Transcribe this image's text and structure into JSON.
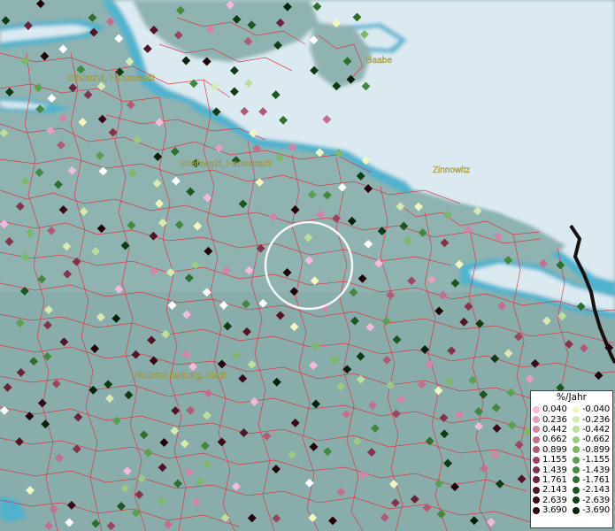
{
  "map": {
    "cities": [
      {
        "name": "Stralsund, Hansestadt"
      },
      {
        "name": "Baabe"
      },
      {
        "name": "Greifswald, Hansestadt"
      },
      {
        "name": "Zinnowitz"
      },
      {
        "name": "Neubrandenburg, Stadt"
      }
    ]
  },
  "legend": {
    "title": "%/Jahr",
    "positive": [
      {
        "value": "0.040",
        "color": "#f4b9dc"
      },
      {
        "value": "0.236",
        "color": "#e39ec0"
      },
      {
        "value": "0.442",
        "color": "#d483a6"
      },
      {
        "value": "0.662",
        "color": "#c46d8c"
      },
      {
        "value": "0.899",
        "color": "#b05a75"
      },
      {
        "value": "1.155",
        "color": "#9b465f"
      },
      {
        "value": "1.439",
        "color": "#83334b"
      },
      {
        "value": "1.761",
        "color": "#6c2238"
      },
      {
        "value": "2.143",
        "color": "#541427"
      },
      {
        "value": "2.639",
        "color": "#3b0a18"
      },
      {
        "value": "3.690",
        "color": "#22030b"
      }
    ],
    "negative": [
      {
        "value": "-0.040",
        "color": "#f2f7c2"
      },
      {
        "value": "-0.236",
        "color": "#d7ebb0"
      },
      {
        "value": "-0.442",
        "color": "#bddf9b"
      },
      {
        "value": "-0.662",
        "color": "#9cca83"
      },
      {
        "value": "-0.899",
        "color": "#7db86a"
      },
      {
        "value": "-1.155",
        "color": "#5d9f51"
      },
      {
        "value": "-1.439",
        "color": "#44873e"
      },
      {
        "value": "-1.761",
        "color": "#2f6f2e"
      },
      {
        "value": "-2.143",
        "color": "#1d5620"
      },
      {
        "value": "-2.639",
        "color": "#103c14"
      },
      {
        "value": "-3.690",
        "color": "#06220a"
      }
    ]
  },
  "colors": {
    "land": "#8fb3b1",
    "sea": "#dbeaf1",
    "coast": "#4fb3cf",
    "boundary": "#e0303a",
    "highlight_circle": "#ffffff",
    "road": "#1a1010"
  }
}
